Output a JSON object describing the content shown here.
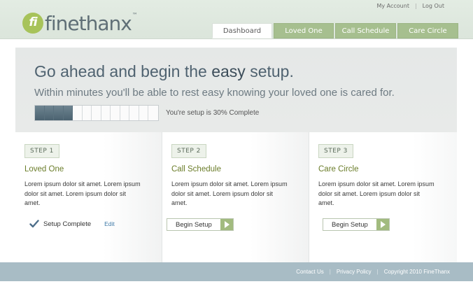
{
  "brand": {
    "logo_mark": "fi",
    "name": "finethanx",
    "trademark": "™"
  },
  "top_links": {
    "my_account": "My Account",
    "log_out": "Log Out"
  },
  "tabs": [
    {
      "label": "Dashboard",
      "active": true
    },
    {
      "label": "Loved One",
      "active": false
    },
    {
      "label": "Call Schedule",
      "active": false
    },
    {
      "label": "Care Circle",
      "active": false
    }
  ],
  "hero": {
    "title_prefix": "Go ahead and begin the ",
    "title_emphasis": "easy",
    "title_suffix": " setup.",
    "subtitle": "Within minutes you'll be able to rest easy knowing your loved one is cared for.",
    "progress_text": "You're setup is 30% Complete",
    "progress_fraction": 0.3,
    "progress_segments_total": 13,
    "progress_segments_filled": 4
  },
  "steps": [
    {
      "badge": "STEP 1",
      "title": "Loved One",
      "text": "Lorem ipsum dolor sit amet. Lorem ipsum dolor sit amet. Lorem ipsum dolor sit amet.",
      "status": "Setup Complete",
      "edit_label": "Edit"
    },
    {
      "badge": "STEP 2",
      "title": "Call Schedule",
      "text": "Lorem ipsum dolor sit amet. Lorem ipsum dolor sit amet. Lorem ipsum dolor sit amet.",
      "button_label": "Begin Setup"
    },
    {
      "badge": "STEP 3",
      "title": "Care Circle",
      "text": "Lorem ipsum dolor sit amet. Lorem ipsum dolor sit amet. Lorem ipsum dolor sit amet.",
      "button_label": "Begin Setup"
    }
  ],
  "footer": {
    "contact": "Contact Us",
    "privacy": "Privacy Policy",
    "copyright": "Copyright 2010 FineThanx"
  },
  "colors": {
    "accent_green": "#a6bf8f",
    "title_green": "#6b7d2a",
    "progress_fill": "#4b6270",
    "footer_bg": "#a8bcc5",
    "link_blue": "#3f7aa8"
  },
  "icons": {
    "check": "check-icon",
    "arrow": "arrow-right-icon"
  }
}
